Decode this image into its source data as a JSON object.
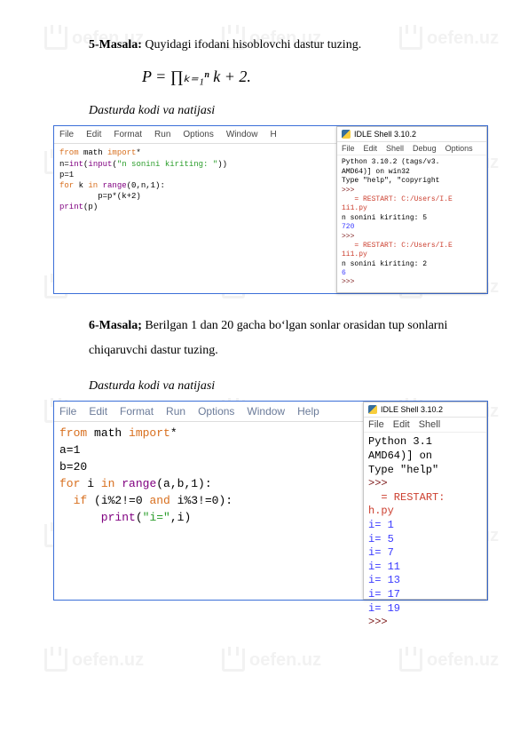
{
  "watermark": "oefen.uz",
  "problem5": {
    "label": "5-Masala:",
    "text": " Quyidagi ifodani hisoblovchi dastur tuzing.",
    "formula": "P = ∏ₖ₌₁ⁿ k + 2."
  },
  "subtitle": "Dasturda kodi va natijasi",
  "problem6": {
    "label": "6-Masala;",
    "text": " Berilgan 1 dan 20 gacha boʻlgan sonlar orasidan tup sonlarni chiqaruvchi dastur tuzing."
  },
  "editor_menu": [
    "File",
    "Edit",
    "Format",
    "Run",
    "Options",
    "Window",
    "H"
  ],
  "shell_menu": [
    "File",
    "Edit",
    "Shell",
    "Debug",
    "Options"
  ],
  "shell_title": "IDLE Shell 3.10.2",
  "code1": {
    "l1a": "from",
    "l1b": " math ",
    "l1c": "import",
    "l1d": "*",
    "l2a": "n=",
    "l2b": "int",
    "l2c": "(",
    "l2d": "input",
    "l2e": "(",
    "l2f": "\"n sonini kiriting: \"",
    "l2g": "))",
    "l3": "p=1",
    "l4a": "for",
    "l4b": " k ",
    "l4c": "in",
    "l4d": " ",
    "l4e": "range",
    "l4f": "(0,n,1):",
    "l5": "        p=p*(k+2)",
    "l6a": "print",
    "l6b": "(p)"
  },
  "shell1": {
    "s1": "Python 3.10.2 (tags/v3.",
    "s2": "AMD64)] on win32",
    "s3": "Type \"help\", \"copyright",
    "p": ">>>",
    "r1": "= RESTART: C:/Users/I.E",
    "r1b": "1i1.py",
    "in1": "n sonini kiriting: 5",
    "out1": "720",
    "r2": "= RESTART: C:/Users/I.E",
    "r2b": "1i1.py",
    "in2": "n sonini kiriting: 2",
    "out2": "6"
  },
  "editor_menu2": [
    "File",
    "Edit",
    "Format",
    "Run",
    "Options",
    "Window",
    "Help"
  ],
  "shell_menu2": [
    "File",
    "Edit",
    "Shell"
  ],
  "code2": {
    "l1a": "from",
    "l1b": " math ",
    "l1c": "import",
    "l1d": "*",
    "l2": "a=1",
    "l3": "b=20",
    "l4a": "for",
    "l4b": " i ",
    "l4c": "in",
    "l4d": " ",
    "l4e": "range",
    "l4f": "(a,b,1):",
    "l5a": "  if",
    "l5b": " (i%2!=0 ",
    "l5c": "and",
    "l5d": " i%3!=0):",
    "l6a": "      print",
    "l6b": "(",
    "l6c": "\"i=\"",
    "l6d": ",i)"
  },
  "shell2": {
    "s1": "Python 3.1",
    "s2": "AMD64)] on",
    "s3": "Type \"help\"",
    "p": ">>>",
    "r1": "= RESTART:",
    "r1b": "h.py",
    "o1": "i= 1",
    "o2": "i= 5",
    "o3": "i= 7",
    "o4": "i= 11",
    "o5": "i= 13",
    "o6": "i= 17",
    "o7": "i= 19"
  }
}
